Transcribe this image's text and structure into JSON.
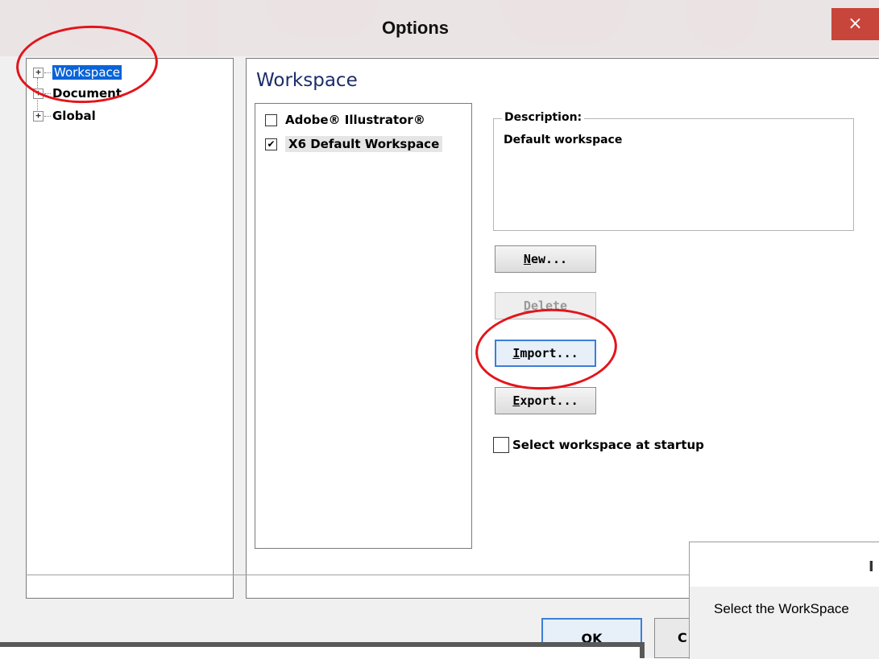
{
  "window": {
    "title": "Options",
    "close_glyph": "×"
  },
  "tree": {
    "expander_glyph": "+",
    "items": [
      {
        "label": "Workspace",
        "selected": true
      },
      {
        "label": "Document",
        "selected": false
      },
      {
        "label": "Global",
        "selected": false
      }
    ]
  },
  "panel": {
    "title": "Workspace"
  },
  "workspaces": [
    {
      "label": "Adobe® Illustrator®",
      "checked": false,
      "check_glyph": ""
    },
    {
      "label": "X6 Default Workspace",
      "checked": true,
      "check_glyph": "✔"
    }
  ],
  "description": {
    "legend": "Description:",
    "text": "Default workspace"
  },
  "buttons": {
    "new": {
      "accel": "N",
      "rest": "ew..."
    },
    "delete": {
      "accel": "D",
      "rest": "elete"
    },
    "import": {
      "accel": "I",
      "rest": "mport..."
    },
    "export": {
      "accel": "E",
      "rest": "xport..."
    }
  },
  "startup": {
    "label": "Select workspace at startup",
    "checked": false
  },
  "footer": {
    "ok_label": "OK",
    "cancel_partial": "C"
  },
  "second_dialog": {
    "title_partial": "I",
    "text": "Select the WorkSpace"
  },
  "colors": {
    "selection": "#0a64d8",
    "annotation": "#e3141b",
    "close_button": "#c7453b",
    "panel_title": "#1b2d6b",
    "focus_border": "#3c7fd8"
  }
}
